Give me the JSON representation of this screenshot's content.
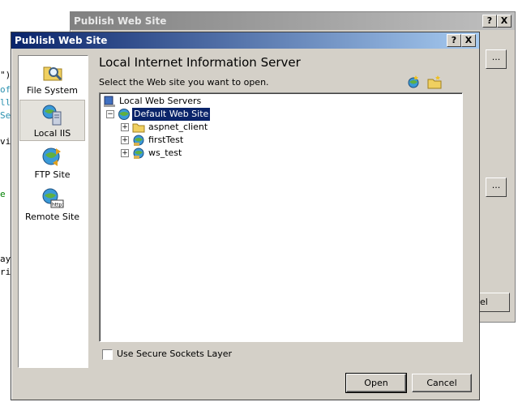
{
  "background_code": {
    "lines": [
      "\")",
      "of",
      "ll",
      "Se",
      "vi",
      "e",
      "ay",
      "ri"
    ]
  },
  "background_dialog": {
    "title": "Publish Web Site",
    "help_button": "?",
    "close_button": "X",
    "ellipsis_1": "...",
    "ellipsis_2": "...",
    "cancel_fragment": "el"
  },
  "dialog": {
    "title": "Publish Web Site",
    "help_button": "?",
    "close_button": "X",
    "heading": "Local Internet Information Server",
    "subtext": "Select the Web site you want to open.",
    "sidebar": [
      {
        "label": "File System",
        "icon": "folder-magnifier-icon",
        "selected": false
      },
      {
        "label": "Local IIS",
        "icon": "server-globe-icon",
        "selected": true
      },
      {
        "label": "FTP Site",
        "icon": "ftp-globe-icon",
        "selected": false
      },
      {
        "label": "Remote Site",
        "icon": "http-globe-icon",
        "selected": false
      }
    ],
    "toolbar": [
      "create-web-application-icon",
      "create-virtual-directory-icon",
      "delete-icon"
    ],
    "tree": {
      "root": "Local Web Servers",
      "site": "Default Web Site",
      "children": [
        "aspnet_client",
        "firstTest",
        "ws_test"
      ]
    },
    "ssl_label": "Use Secure Sockets Layer",
    "open_button": "Open",
    "cancel_button": "Cancel"
  }
}
